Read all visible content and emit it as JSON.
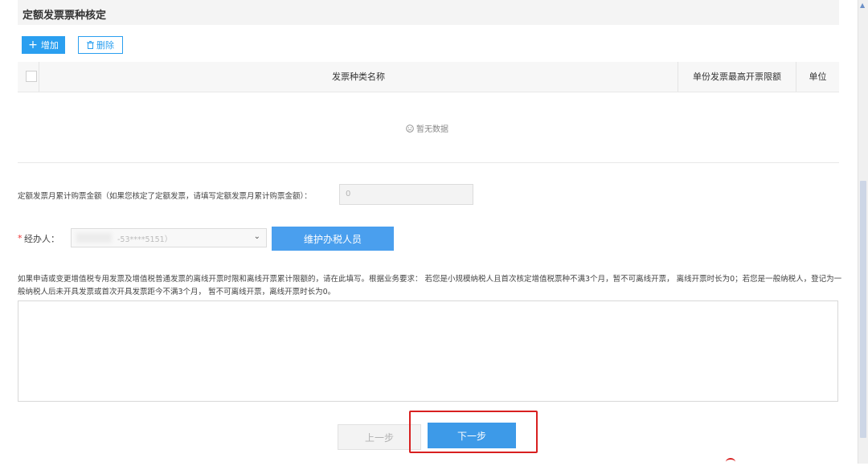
{
  "section": {
    "title": "定额发票票种核定"
  },
  "toolbar": {
    "add_icon": "plus-icon",
    "add_label": "增加",
    "delete_icon": "trash-icon",
    "delete_label": "删除"
  },
  "table": {
    "columns": [
      "发票种类名称",
      "单份发票最高开票限额",
      "单位"
    ],
    "rows": [],
    "empty_icon": "sad-face-icon",
    "empty_text": "暂无数据"
  },
  "amount": {
    "label": "定额发票月累计购票金额（如果您核定了定额发票，请填写定额发票月累计购票金额）：",
    "value": "0"
  },
  "handler": {
    "required_mark": "*",
    "label": "经办人：",
    "value": "-53****5151）",
    "maintain_label": "维护办税人员"
  },
  "notice": {
    "text": "如果申请或变更增值税专用发票及增值税普通发票的离线开票时限和离线开票累计限额的，请在此填写。根据业务要求： 若您是小规模纳税人且首次核定增值税票种不满3个月，暂不可离线开票， 离线开票时长为0；若您是一般纳税人，登记为一般纳税人后未开具发票或首次开具发票距今不满3个月， 暂不可离线开票，离线开票时长为0。",
    "input_value": ""
  },
  "nav": {
    "prev_label": "上一步",
    "next_label": "下一步"
  },
  "colors": {
    "primary": "#2a9ff0",
    "button_blue": "#4a9fee",
    "highlight": "#d82020",
    "required": "#e33333"
  }
}
